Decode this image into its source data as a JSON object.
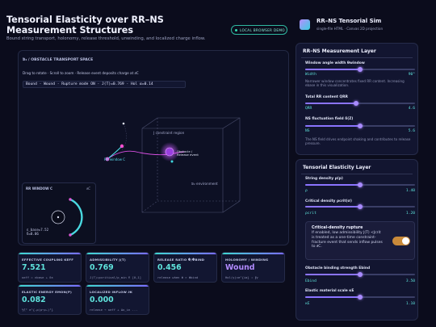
{
  "header": {
    "title": "Tensorial Elasticity over RR–NS Measurement Structures",
    "subtitle": "Bound string transport, holonomy, release threshold, unwinding, and localized charge inflow.",
    "badge": "LOCAL BROWSER DEMO"
  },
  "space": {
    "label": "𝔅₂ / OBSTACLE TRANSPORT SPACE",
    "hint": "Drag to rotate · Scroll to zoom · Release event deposits charge at ∂C",
    "status": "Bound · Wound · Rupture mode ON · J(T)=0.769 · Hol α=0.14",
    "labels": {
      "constraint": "J constraint region",
      "obstacle": "Obstacle /",
      "release": "Release event",
      "window": "RR window C",
      "environment": "𝔅₂ environment"
    }
  },
  "rr_window": {
    "title": "RR WINDOW C",
    "corner": "∂C",
    "readout_line1": "ε_base=7.52",
    "readout_line2": "δ=0.06"
  },
  "cards": [
    {
      "label": "EFFECTIVE COUPLING KEFF",
      "value": "7.521",
      "sub": "κeff = εbase + δε"
    },
    {
      "label": "ADMISSIBILITY J(T)",
      "value": "0.769",
      "sub": "J(T)=ρcritical/ρ_min ∈ [0,1]"
    },
    {
      "label": "RELEASE RATIO Φ/ΦBIND",
      "value": "0.456",
      "sub": "release when Φ > Φbind"
    },
    {
      "label": "HOLONOMY / WINDING",
      "value": "Wound",
      "sub": "Hol(γ)≈e^{iα} ⇒ ∮γ"
    },
    {
      "label": "ELASTIC ENERGY EMON(P)",
      "value": "0.082",
      "sub": "½ξ² e^{‑ρ(p−ρₕ)²}"
    },
    {
      "label": "LOCALIZED INFLOW ∂K",
      "value": "0.000",
      "sub": "release → κeff + Δκ_in ..."
    }
  ],
  "sidebar": {
    "app_name": "RR–NS Tensorial Sim",
    "app_sub": "single-file HTML · Canvas 2D projection",
    "measurement": {
      "title": "RR–NS Measurement Layer",
      "window": {
        "label": "Window angle width θwindow",
        "sym": "Width",
        "value": "90°",
        "fraction": 0.5,
        "desc": "Narrower window concentrates fixed RR content. Increasing ebase in this visualization."
      },
      "content": {
        "label": "Total RR content QRR",
        "sym": "QRR",
        "value": "4.6",
        "fraction": 0.46
      },
      "fluct": {
        "label": "NS fluctuation field δ(Z)",
        "sym": "NS",
        "value": "5.6",
        "fraction": 0.5,
        "desc": "The NS field drives endpoint shaking and contributes to release pressure."
      }
    },
    "elasticity": {
      "title": "Tensorial Elasticity Layer",
      "density": {
        "label": "String density ρ(p)",
        "sym": "ρ",
        "value": "1.40",
        "fraction": 0.5
      },
      "critical": {
        "label": "Critical density ρcrit(σ)",
        "sym": "ρcrit",
        "value": "1.20",
        "fraction": 0.5
      },
      "rupture": {
        "title": "Critical-density rupture",
        "text": "If enabled, low admissibility J(T) <Jcrit is treated as a one-time constraint-fracture event that sends inflow pulses to ∂C.",
        "enabled": true
      },
      "obstacle": {
        "label": "Obstacle binding strength Ebind",
        "sym": "Ebind",
        "value": "3.50",
        "fraction": 0.5
      },
      "scale": {
        "label": "Elastic material scale κE",
        "sym": "κE",
        "value": "1.10",
        "fraction": 0.5
      }
    }
  }
}
